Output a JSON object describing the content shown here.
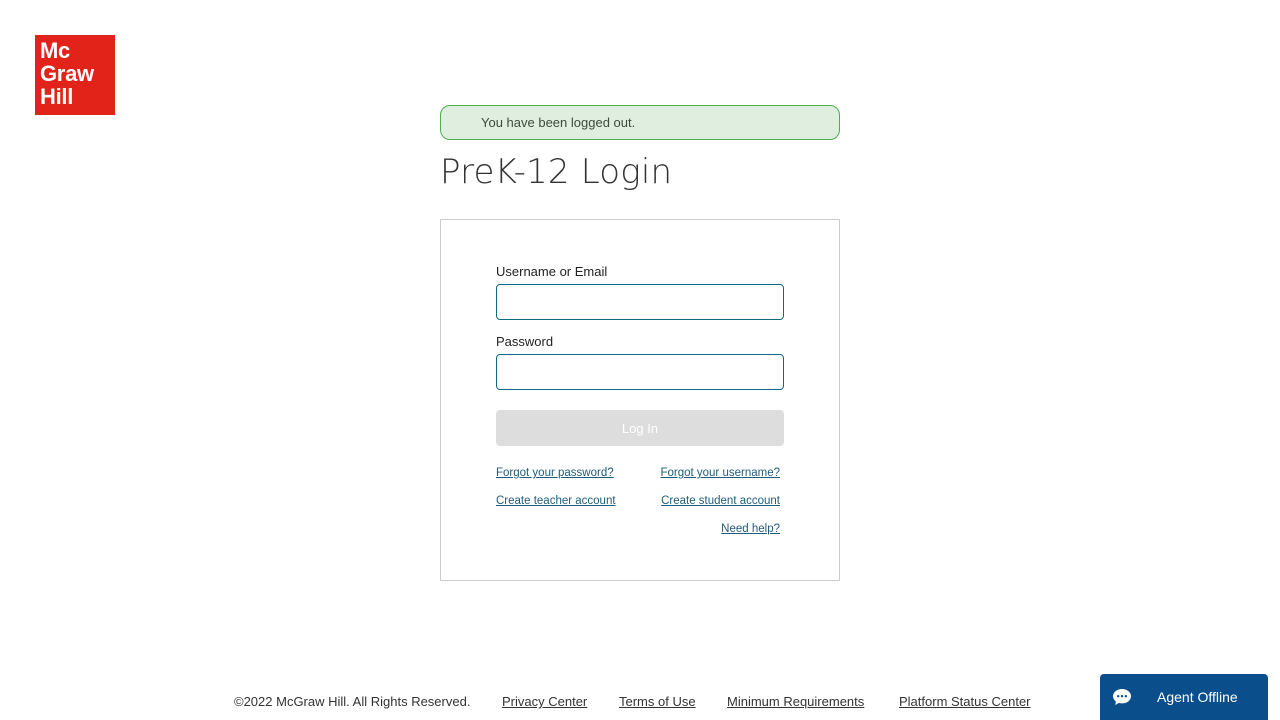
{
  "logo": {
    "lines": [
      "Mc",
      "Graw",
      "Hill"
    ],
    "color": "#e2231a"
  },
  "alert": {
    "message": "You have been logged out."
  },
  "page": {
    "title": "PreK-12 Login"
  },
  "login_form": {
    "username_label": "Username or Email",
    "username_value": "",
    "password_label": "Password",
    "password_value": "",
    "submit_label": "Log In",
    "links": {
      "forgot_password": "Forgot your password?",
      "forgot_username": "Forgot your username?",
      "create_teacher": "Create teacher account",
      "create_student": "Create student account",
      "need_help": "Need help?"
    }
  },
  "footer": {
    "copyright": "©2022 McGraw Hill. All Rights Reserved.",
    "links": [
      "Privacy Center",
      "Terms of Use",
      "Minimum Requirements",
      "Platform Status Center"
    ]
  },
  "chat": {
    "icon": "chat-bubble-icon",
    "label": "Agent Offline",
    "color": "#0a4f8c"
  }
}
